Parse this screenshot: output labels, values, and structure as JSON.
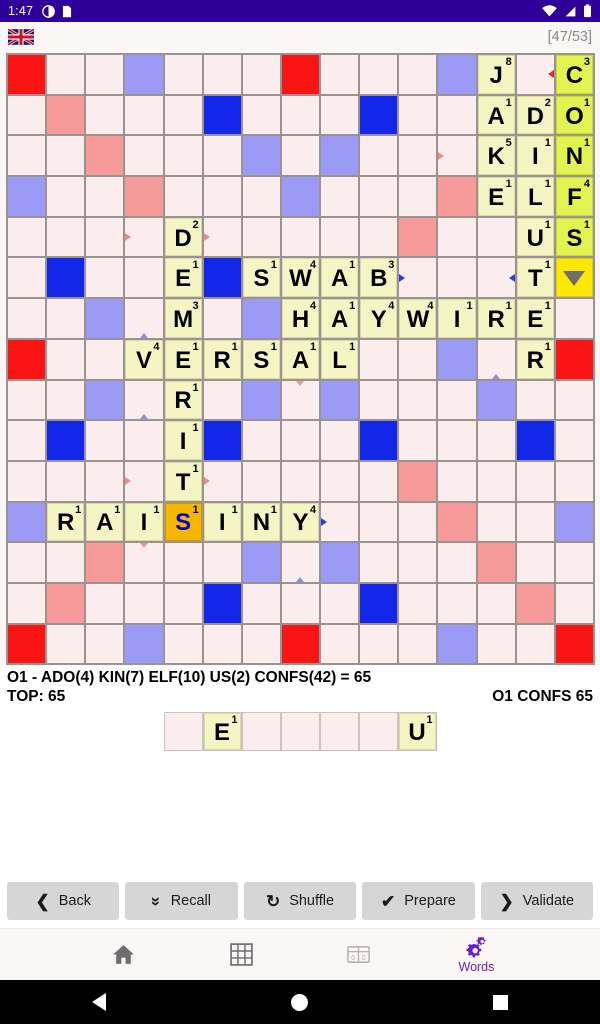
{
  "statusbar": {
    "time": "1:47",
    "icons": [
      "clock-badge-icon",
      "sim-card-icon",
      "wifi-icon",
      "signal-icon",
      "battery-icon"
    ]
  },
  "appheader": {
    "flag_icon": "uk-flag-icon",
    "tile_counter": "[47/53]"
  },
  "board": {
    "rows": 15,
    "cols": 15,
    "premium_colors": {
      "triple_word": "#fa1414",
      "double_word": "#9b9bf7",
      "triple_letter": "#1226e8",
      "double_letter": "#f79a9a",
      "empty": "#fbedee"
    },
    "tile_colors": {
      "placed": "#f5f5c3",
      "new": "#e2f24e",
      "selected": "#f5b600",
      "cursor": "#ffe800"
    },
    "words_on_board": [
      "JAKE",
      "DILUTE",
      "CONFS",
      "ADO",
      "KIN",
      "ELF",
      "US",
      "DEMERITS",
      "SWAB",
      "HAYWIRE",
      "VERSAL",
      "RAISINY",
      "RER"
    ],
    "cells": [
      [
        {
          "p": "tws"
        },
        {
          "p": ""
        },
        {
          "p": ""
        },
        {
          "p": "dws"
        },
        {
          "p": ""
        },
        {
          "p": ""
        },
        {
          "p": ""
        },
        {
          "p": "tws"
        },
        {
          "p": ""
        },
        {
          "p": ""
        },
        {
          "p": ""
        },
        {
          "p": "dws"
        },
        {
          "p": "",
          "t": "J",
          "s": "8"
        },
        {
          "p": "",
          "a": "rright"
        },
        {
          "p": "",
          "t": "C",
          "s": "3",
          "n": true
        }
      ],
      [
        {
          "p": ""
        },
        {
          "p": "dls"
        },
        {
          "p": ""
        },
        {
          "p": ""
        },
        {
          "p": ""
        },
        {
          "p": "tls"
        },
        {
          "p": ""
        },
        {
          "p": ""
        },
        {
          "p": ""
        },
        {
          "p": "tls"
        },
        {
          "p": ""
        },
        {
          "p": ""
        },
        {
          "p": "",
          "t": "A",
          "s": "1"
        },
        {
          "p": "",
          "t": "D",
          "s": "2"
        },
        {
          "p": "",
          "t": "O",
          "s": "1",
          "n": true
        }
      ],
      [
        {
          "p": ""
        },
        {
          "p": ""
        },
        {
          "p": "dls"
        },
        {
          "p": ""
        },
        {
          "p": ""
        },
        {
          "p": ""
        },
        {
          "p": "dws"
        },
        {
          "p": ""
        },
        {
          "p": "dws"
        },
        {
          "p": ""
        },
        {
          "p": ""
        },
        {
          "p": "",
          "a": "rleft"
        },
        {
          "p": "",
          "t": "K",
          "s": "5"
        },
        {
          "p": "",
          "t": "I",
          "s": "1"
        },
        {
          "p": "",
          "t": "N",
          "s": "1",
          "n": true
        }
      ],
      [
        {
          "p": "dws"
        },
        {
          "p": ""
        },
        {
          "p": ""
        },
        {
          "p": "dls"
        },
        {
          "p": ""
        },
        {
          "p": ""
        },
        {
          "p": ""
        },
        {
          "p": "dws"
        },
        {
          "p": ""
        },
        {
          "p": ""
        },
        {
          "p": ""
        },
        {
          "p": "dls"
        },
        {
          "p": "",
          "t": "E",
          "s": "1"
        },
        {
          "p": "",
          "t": "L",
          "s": "1"
        },
        {
          "p": "",
          "t": "F",
          "s": "4",
          "n": true
        }
      ],
      [
        {
          "p": ""
        },
        {
          "p": ""
        },
        {
          "p": ""
        },
        {
          "p": "",
          "a": "rleft"
        },
        {
          "p": "",
          "t": "D",
          "s": "2"
        },
        {
          "p": "",
          "a": "rleft"
        },
        {
          "p": ""
        },
        {
          "p": ""
        },
        {
          "p": ""
        },
        {
          "p": ""
        },
        {
          "p": "dls"
        },
        {
          "p": ""
        },
        {
          "p": ""
        },
        {
          "p": "",
          "t": "U",
          "s": "1"
        },
        {
          "p": "",
          "t": "S",
          "s": "1",
          "n": true
        }
      ],
      [
        {
          "p": ""
        },
        {
          "p": "tls"
        },
        {
          "p": ""
        },
        {
          "p": ""
        },
        {
          "p": "",
          "t": "E",
          "s": "1"
        },
        {
          "p": "tls"
        },
        {
          "p": "",
          "t": "S",
          "s": "1"
        },
        {
          "p": "",
          "t": "W",
          "s": "4"
        },
        {
          "p": "",
          "t": "A",
          "s": "1"
        },
        {
          "p": "",
          "t": "B",
          "s": "3"
        },
        {
          "p": "",
          "a": "left"
        },
        {
          "p": ""
        },
        {
          "p": "",
          "a": "right"
        },
        {
          "p": "",
          "t": "T",
          "s": "1"
        },
        {
          "p": "",
          "c": true
        }
      ],
      [
        {
          "p": ""
        },
        {
          "p": ""
        },
        {
          "p": "dws"
        },
        {
          "p": "",
          "a": "down"
        },
        {
          "p": "",
          "t": "M",
          "s": "3"
        },
        {
          "p": ""
        },
        {
          "p": "dws"
        },
        {
          "p": "",
          "t": "H",
          "s": "4"
        },
        {
          "p": "",
          "t": "A",
          "s": "1"
        },
        {
          "p": "",
          "t": "Y",
          "s": "4"
        },
        {
          "p": "",
          "t": "W",
          "s": "4"
        },
        {
          "p": "",
          "t": "I",
          "s": "1"
        },
        {
          "p": "",
          "t": "R",
          "s": "1"
        },
        {
          "p": "",
          "t": "E",
          "s": "1"
        },
        {
          "p": ""
        }
      ],
      [
        {
          "p": "tws"
        },
        {
          "p": ""
        },
        {
          "p": ""
        },
        {
          "p": "",
          "t": "V",
          "s": "4"
        },
        {
          "p": "",
          "t": "E",
          "s": "1"
        },
        {
          "p": "",
          "t": "R",
          "s": "1"
        },
        {
          "p": "",
          "t": "S",
          "s": "1"
        },
        {
          "p": "",
          "t": "A",
          "s": "1"
        },
        {
          "p": "",
          "t": "L",
          "s": "1"
        },
        {
          "p": ""
        },
        {
          "p": ""
        },
        {
          "p": "dws"
        },
        {
          "p": "",
          "a": "down"
        },
        {
          "p": "",
          "t": "R",
          "s": "1"
        },
        {
          "p": "tws"
        }
      ],
      [
        {
          "p": ""
        },
        {
          "p": ""
        },
        {
          "p": "dws"
        },
        {
          "p": "",
          "a": "down"
        },
        {
          "p": "",
          "t": "R",
          "s": "1"
        },
        {
          "p": ""
        },
        {
          "p": "dws"
        },
        {
          "p": "",
          "a": "up"
        },
        {
          "p": "dws"
        },
        {
          "p": ""
        },
        {
          "p": ""
        },
        {
          "p": ""
        },
        {
          "p": "dws"
        },
        {
          "p": ""
        },
        {
          "p": ""
        }
      ],
      [
        {
          "p": ""
        },
        {
          "p": "tls"
        },
        {
          "p": ""
        },
        {
          "p": ""
        },
        {
          "p": "",
          "t": "I",
          "s": "1"
        },
        {
          "p": "tls"
        },
        {
          "p": ""
        },
        {
          "p": ""
        },
        {
          "p": ""
        },
        {
          "p": "tls"
        },
        {
          "p": ""
        },
        {
          "p": ""
        },
        {
          "p": ""
        },
        {
          "p": "tls"
        },
        {
          "p": ""
        }
      ],
      [
        {
          "p": ""
        },
        {
          "p": ""
        },
        {
          "p": ""
        },
        {
          "p": "",
          "a": "rleft"
        },
        {
          "p": "",
          "t": "T",
          "s": "1"
        },
        {
          "p": "",
          "a": "rleft"
        },
        {
          "p": ""
        },
        {
          "p": ""
        },
        {
          "p": ""
        },
        {
          "p": ""
        },
        {
          "p": "dls"
        },
        {
          "p": ""
        },
        {
          "p": ""
        },
        {
          "p": ""
        },
        {
          "p": ""
        }
      ],
      [
        {
          "p": "dws"
        },
        {
          "p": "",
          "t": "R",
          "s": "1"
        },
        {
          "p": "",
          "t": "A",
          "s": "1"
        },
        {
          "p": "",
          "t": "I",
          "s": "1"
        },
        {
          "p": "",
          "t": "S",
          "s": "1",
          "sel": true
        },
        {
          "p": "",
          "t": "I",
          "s": "1"
        },
        {
          "p": "",
          "t": "N",
          "s": "1"
        },
        {
          "p": "",
          "t": "Y",
          "s": "4"
        },
        {
          "p": "",
          "a": "left"
        },
        {
          "p": ""
        },
        {
          "p": ""
        },
        {
          "p": "dls"
        },
        {
          "p": ""
        },
        {
          "p": ""
        },
        {
          "p": "dws"
        }
      ],
      [
        {
          "p": ""
        },
        {
          "p": ""
        },
        {
          "p": "dls"
        },
        {
          "p": "",
          "a": "up"
        },
        {
          "p": ""
        },
        {
          "p": ""
        },
        {
          "p": "dws"
        },
        {
          "p": "",
          "a": "down"
        },
        {
          "p": "dws"
        },
        {
          "p": ""
        },
        {
          "p": ""
        },
        {
          "p": ""
        },
        {
          "p": "dls"
        },
        {
          "p": ""
        },
        {
          "p": ""
        }
      ],
      [
        {
          "p": ""
        },
        {
          "p": "dls"
        },
        {
          "p": ""
        },
        {
          "p": ""
        },
        {
          "p": ""
        },
        {
          "p": "tls"
        },
        {
          "p": ""
        },
        {
          "p": ""
        },
        {
          "p": ""
        },
        {
          "p": "tls"
        },
        {
          "p": ""
        },
        {
          "p": ""
        },
        {
          "p": ""
        },
        {
          "p": "dls"
        },
        {
          "p": ""
        }
      ],
      [
        {
          "p": "tws"
        },
        {
          "p": ""
        },
        {
          "p": ""
        },
        {
          "p": "dws"
        },
        {
          "p": ""
        },
        {
          "p": ""
        },
        {
          "p": ""
        },
        {
          "p": "tws"
        },
        {
          "p": ""
        },
        {
          "p": ""
        },
        {
          "p": ""
        },
        {
          "p": "dws"
        },
        {
          "p": ""
        },
        {
          "p": ""
        },
        {
          "p": "tws"
        }
      ]
    ]
  },
  "score": {
    "line1": "O1 - ADO(4) KIN(7) ELF(10) US(2) CONFS(42)  = 65",
    "top_label": "TOP: 65",
    "best_move": "O1 CONFS 65"
  },
  "rack": {
    "slots": [
      {
        "letter": "",
        "points": ""
      },
      {
        "letter": "E",
        "points": "1"
      },
      {
        "letter": "",
        "points": ""
      },
      {
        "letter": "",
        "points": ""
      },
      {
        "letter": "",
        "points": ""
      },
      {
        "letter": "",
        "points": ""
      },
      {
        "letter": "U",
        "points": "1"
      }
    ]
  },
  "actions": [
    {
      "label": "Back",
      "icon": "chevron-left-icon"
    },
    {
      "label": "Recall",
      "icon": "double-chevron-down-icon"
    },
    {
      "label": "Shuffle",
      "icon": "refresh-cycle-icon"
    },
    {
      "label": "Prepare",
      "icon": "checkmark-icon"
    },
    {
      "label": "Validate",
      "icon": "chevron-right-icon"
    }
  ],
  "navbar": {
    "items": [
      {
        "label": "",
        "icon": "home-icon",
        "active": false
      },
      {
        "label": "",
        "icon": "grid-icon",
        "active": false
      },
      {
        "label": "",
        "icon": "counter-icon",
        "active": false
      },
      {
        "label": "Words",
        "icon": "gears-icon",
        "active": true
      }
    ],
    "active_color": "#6a1fd0"
  },
  "androidnav": {
    "buttons": [
      "back-triangle-icon",
      "home-circle-icon",
      "recents-square-icon"
    ]
  }
}
